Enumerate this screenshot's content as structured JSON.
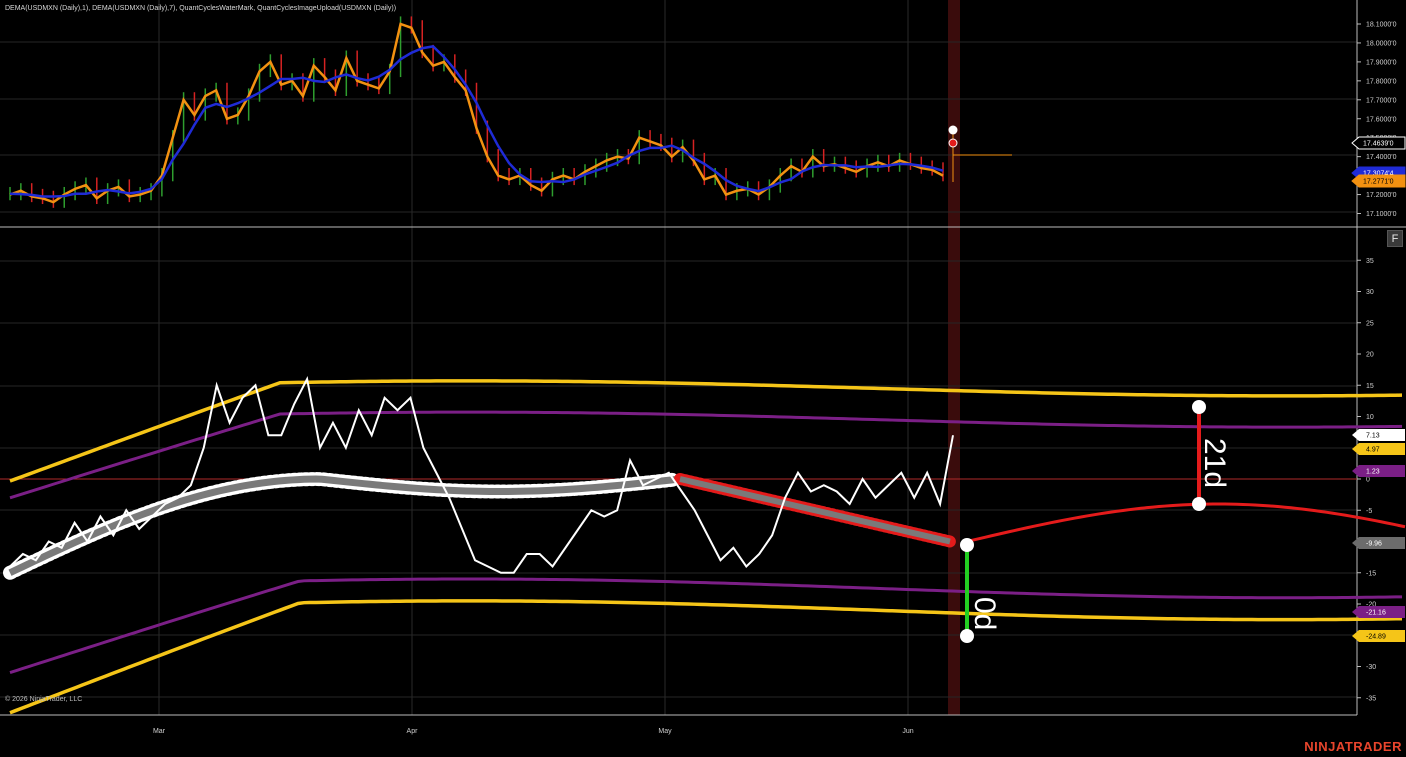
{
  "indicator_title": "DEMA(USDMXN (Daily),1), DEMA(USDMXN (Daily),7), QuantCyclesWaterMark, QuantCyclesImageUpload(USDMXN (Daily))",
  "copyright": "© 2026 NinjaTrader, LLC",
  "brand": "NINJATRADER",
  "panel_button": "F",
  "months": [
    "Mar",
    "Apr",
    "May",
    "Jun"
  ],
  "price_axis": [
    "18.1000'0",
    "18.0000'0",
    "17.9000'0",
    "17.8000'0",
    "17.7000'0",
    "17.6000'0",
    "17.5000'0",
    "17.4000'0",
    "17.3000'0",
    "17.2000'0",
    "17.1000'0"
  ],
  "price_tags": [
    {
      "text": "17.4639'0",
      "bg": "#000000",
      "fg": "#ffffff",
      "border": "#ffffff"
    },
    {
      "text": "17.3074'4",
      "bg": "#1f2bd6",
      "fg": "#ffffff",
      "border": "#1f2bd6"
    },
    {
      "text": "17.2771'0",
      "bg": "#f29111",
      "fg": "#000000",
      "border": "#f29111"
    }
  ],
  "osc_axis": [
    "35",
    "30",
    "25",
    "20",
    "15",
    "10",
    "5",
    "0",
    "-5",
    "-10",
    "-15",
    "-20",
    "-25",
    "-30",
    "-35"
  ],
  "osc_tags": [
    {
      "text": "7.13",
      "bg": "#ffffff",
      "fg": "#000000"
    },
    {
      "text": "4.97",
      "bg": "#f5c518",
      "fg": "#000000"
    },
    {
      "text": "1.23",
      "bg": "#7b1f86",
      "fg": "#ffffff"
    },
    {
      "text": "-9.96",
      "bg": "#6c6c6c",
      "fg": "#ffffff"
    },
    {
      "text": "-21.16",
      "bg": "#7b1f86",
      "fg": "#ffffff"
    },
    {
      "text": "-24.89",
      "bg": "#f5c518",
      "fg": "#000000"
    }
  ],
  "annotations": {
    "top_label": "21d",
    "bottom_label": "0d"
  },
  "colors": {
    "dema_fast": "#f29111",
    "dema_slow": "#1f2bd6",
    "up_bar": "#2e9e2e",
    "down_bar": "#d62222",
    "band_outer": "#f5c518",
    "band_inner": "#7b1f86",
    "cycle_past": "#7a7a7a",
    "cycle_future": "#e41b1b",
    "oscillator": "#ffffff",
    "highlight": "#3a0c0c"
  }
}
